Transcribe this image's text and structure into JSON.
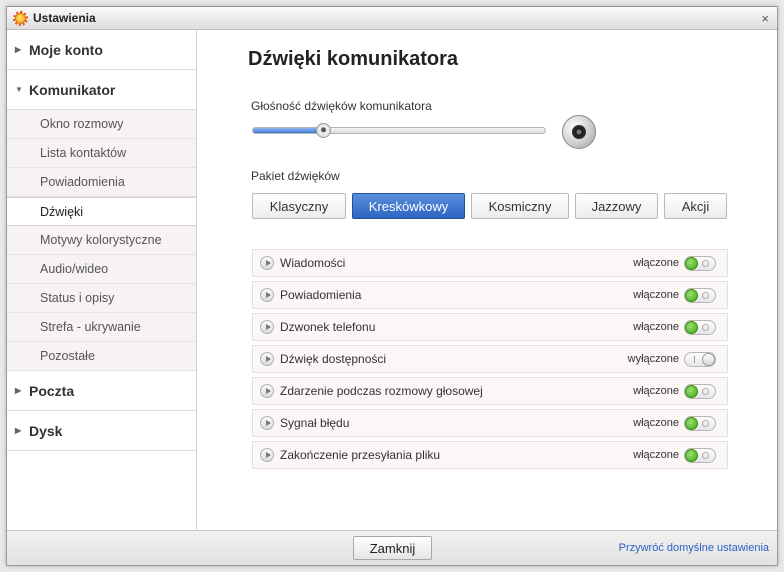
{
  "window": {
    "title": "Ustawienia",
    "close_symbol": "×"
  },
  "sidebar": {
    "sections": [
      {
        "label": "Moje konto",
        "expanded": false
      },
      {
        "label": "Komunikator",
        "expanded": true,
        "items": [
          "Okno rozmowy",
          "Lista kontaktów",
          "Powiadomienia",
          "Dźwięki",
          "Motywy kolorystyczne",
          "Audio/wideo",
          "Status i opisy",
          "Strefa - ukrywanie",
          "Pozostałe"
        ],
        "active_item": "Dźwięki"
      },
      {
        "label": "Poczta",
        "expanded": false
      },
      {
        "label": "Dysk",
        "expanded": false
      }
    ]
  },
  "main": {
    "title": "Dźwięki komunikatora",
    "volume": {
      "label": "Głośność dźwięków komunikatora",
      "level_fraction": 0.24
    },
    "pack": {
      "label": "Pakiet dźwięków",
      "options": [
        "Klasyczny",
        "Kreskówkowy",
        "Kosmiczny",
        "Jazzowy",
        "Akcji"
      ],
      "selected": "Kreskówkowy"
    },
    "events": [
      {
        "name": "Wiadomości",
        "status": "włączone",
        "on": true
      },
      {
        "name": "Powiadomienia",
        "status": "włączone",
        "on": true
      },
      {
        "name": "Dzwonek telefonu",
        "status": "włączone",
        "on": true
      },
      {
        "name": "Dźwięk dostępności",
        "status": "wyłączone",
        "on": false
      },
      {
        "name": "Zdarzenie podczas rozmowy głosowej",
        "status": "włączone",
        "on": true
      },
      {
        "name": "Sygnał błędu",
        "status": "włączone",
        "on": true
      },
      {
        "name": "Zakończenie przesyłania pliku",
        "status": "włączone",
        "on": true
      }
    ]
  },
  "footer": {
    "close_label": "Zamknij",
    "restore_label": "Przywróć domyślne ustawienia"
  },
  "colors": {
    "accent": "#2d65c3",
    "toggle_on": "#3ea316",
    "link": "#2a62c6"
  }
}
